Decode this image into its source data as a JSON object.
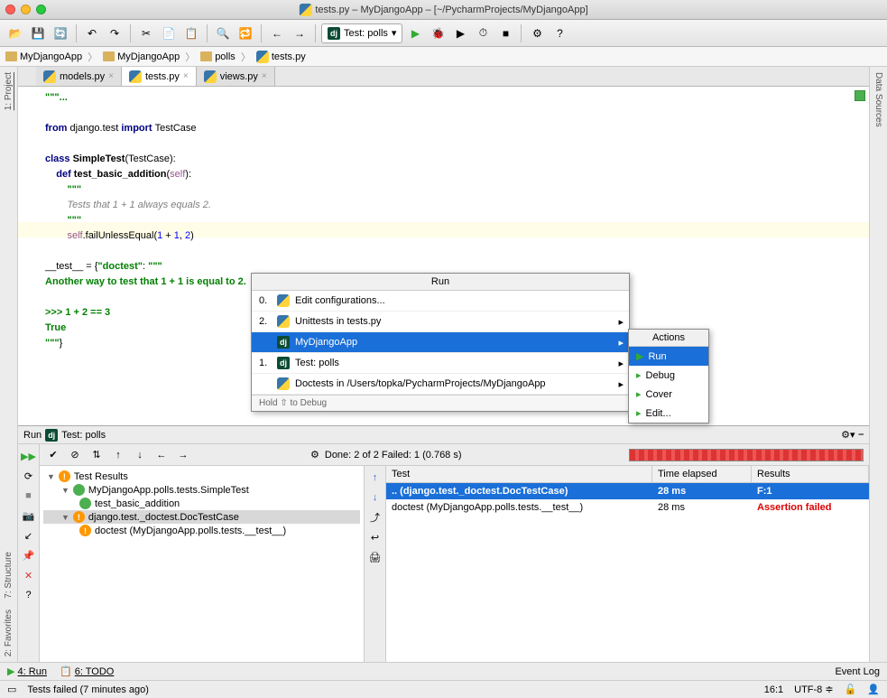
{
  "window": {
    "title": "tests.py – MyDjangoApp – [~/PycharmProjects/MyDjangoApp]"
  },
  "toolbar": {
    "run_config": "Test: polls"
  },
  "breadcrumb": {
    "items": [
      "MyDjangoApp",
      "MyDjangoApp",
      "polls",
      "tests.py"
    ]
  },
  "editor": {
    "tabs": [
      {
        "label": "models.py",
        "active": false
      },
      {
        "label": "tests.py",
        "active": true
      },
      {
        "label": "views.py",
        "active": false
      }
    ],
    "code_lines": [
      {
        "segs": [
          {
            "t": "\"\"\"",
            "c": "str"
          },
          {
            "t": "...",
            "c": "str"
          }
        ]
      },
      {
        "segs": []
      },
      {
        "segs": [
          {
            "t": "from ",
            "c": "kw"
          },
          {
            "t": "django.test "
          },
          {
            "t": "import ",
            "c": "kw"
          },
          {
            "t": "TestCase"
          }
        ]
      },
      {
        "segs": []
      },
      {
        "segs": [
          {
            "t": "class ",
            "c": "kw"
          },
          {
            "t": "SimpleTest",
            "b": true
          },
          {
            "t": "(TestCase):"
          }
        ]
      },
      {
        "segs": [
          {
            "t": "    "
          },
          {
            "t": "def ",
            "c": "kw"
          },
          {
            "t": "test_basic_addition",
            "b": true
          },
          {
            "t": "("
          },
          {
            "t": "self",
            "c": "self"
          },
          {
            "t": "):"
          }
        ]
      },
      {
        "segs": [
          {
            "t": "        "
          },
          {
            "t": "\"\"\"",
            "c": "str"
          }
        ]
      },
      {
        "segs": [
          {
            "t": "        "
          },
          {
            "t": "Tests that 1 + 1 always equals 2.",
            "c": "cmt"
          }
        ]
      },
      {
        "segs": [
          {
            "t": "        "
          },
          {
            "t": "\"\"\"",
            "c": "str"
          }
        ]
      },
      {
        "segs": [
          {
            "t": "        "
          },
          {
            "t": "self",
            "c": "self"
          },
          {
            "t": ".failUnlessEqual("
          },
          {
            "t": "1",
            "c": "num"
          },
          {
            "t": " + "
          },
          {
            "t": "1",
            "c": "num"
          },
          {
            "t": ", "
          },
          {
            "t": "2",
            "c": "num"
          },
          {
            "t": ")"
          }
        ]
      },
      {
        "segs": []
      },
      {
        "segs": [
          {
            "t": "__test__ = {"
          },
          {
            "t": "\"doctest\"",
            "c": "str"
          },
          {
            "t": ": "
          },
          {
            "t": "\"\"\"",
            "c": "str"
          }
        ]
      },
      {
        "segs": [
          {
            "t": "Another way to test that 1 + 1 is equal to 2.",
            "c": "doct"
          }
        ]
      },
      {
        "segs": []
      },
      {
        "segs": [
          {
            "t": ">>> 1 + 2 == 3",
            "c": "doct"
          }
        ]
      },
      {
        "segs": [
          {
            "t": "True",
            "c": "doct"
          }
        ]
      },
      {
        "segs": [
          {
            "t": "\"\"\"",
            "c": "str"
          },
          {
            "t": "}"
          }
        ]
      }
    ]
  },
  "run_popup": {
    "title": "Run",
    "items": [
      {
        "num": "0.",
        "label": "Edit configurations..."
      },
      {
        "num": "2.",
        "label": "Unittests in tests.py",
        "arrow": true
      },
      {
        "num": "",
        "label": "MyDjangoApp",
        "arrow": true,
        "sel": true,
        "icon": "dj"
      },
      {
        "num": "1.",
        "label": "Test: polls",
        "arrow": true,
        "icon": "dj"
      },
      {
        "num": "",
        "label": "Doctests in /Users/topka/PycharmProjects/MyDjangoApp",
        "arrow": true
      }
    ],
    "footer": "Hold ⇧ to Debug"
  },
  "actions_menu": {
    "title": "Actions",
    "items": [
      {
        "label": "Run",
        "sel": true
      },
      {
        "label": "Debug"
      },
      {
        "label": "Cover"
      },
      {
        "label": "Edit..."
      }
    ]
  },
  "run_panel": {
    "header": "Run",
    "config": "Test: polls",
    "done_text": "Done: 2 of 2  Failed: 1  (0.768 s)",
    "tree": [
      {
        "label": "Test Results",
        "level": 0,
        "icon": "warn"
      },
      {
        "label": "MyDjangoApp.polls.tests.SimpleTest",
        "level": 1,
        "icon": "ok"
      },
      {
        "label": "test_basic_addition",
        "level": 2,
        "icon": "ok"
      },
      {
        "label": "django.test._doctest.DocTestCase",
        "level": 1,
        "icon": "warn",
        "sel": true
      },
      {
        "label": "doctest (MyDjangoApp.polls.tests.__test__)",
        "level": 2,
        "icon": "warn"
      }
    ],
    "results": {
      "headers": {
        "test": "Test",
        "time": "Time elapsed",
        "res": "Results"
      },
      "rows": [
        {
          "test": ".. (django.test._doctest.DocTestCase)",
          "time": "28 ms",
          "res": "F:1",
          "sel": true
        },
        {
          "test": "doctest (MyDjangoApp.polls.tests.__test__)",
          "time": "28 ms",
          "res": "Assertion failed",
          "fail": true
        }
      ]
    }
  },
  "bottom_tabs": {
    "run": "4: Run",
    "todo": "6: TODO",
    "event_log": "Event Log"
  },
  "statusbar": {
    "msg": "Tests failed (7 minutes ago)",
    "pos": "16:1",
    "encoding": "UTF-8"
  },
  "side_tabs": {
    "project": "1: Project",
    "structure": "7: Structure",
    "favorites": "2: Favorites",
    "data_sources": "Data Sources"
  }
}
